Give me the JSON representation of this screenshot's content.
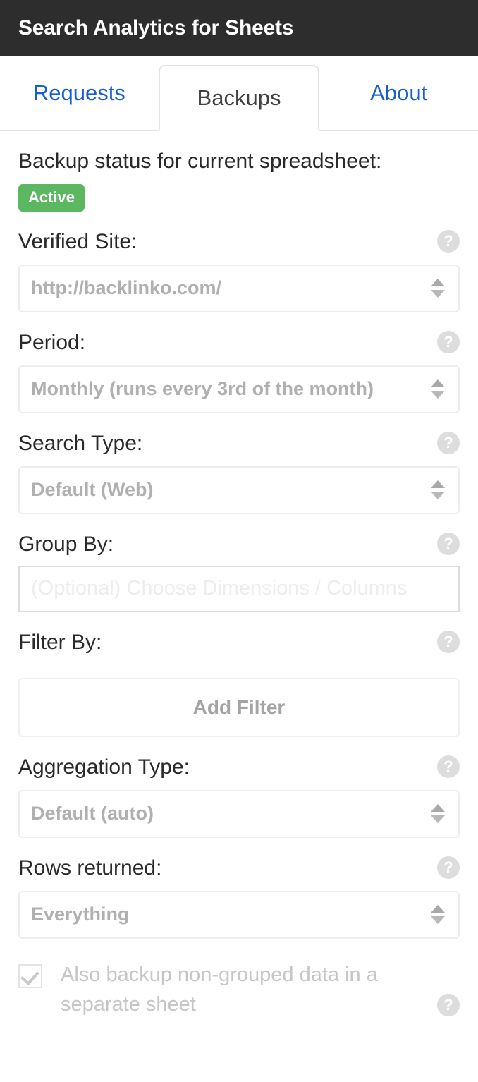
{
  "header": {
    "title": "Search Analytics for Sheets",
    "background_color": "#2d2d2d",
    "title_color": "#ffffff"
  },
  "tabs": [
    {
      "label": "Requests",
      "active": false
    },
    {
      "label": "Backups",
      "active": true
    },
    {
      "label": "About",
      "active": false
    }
  ],
  "tab_colors": {
    "inactive_text": "#1a5fd0",
    "active_text": "#3f3f3f",
    "border": "#e3e3e3"
  },
  "status": {
    "label": "Backup status for current spreadsheet:",
    "badge_text": "Active",
    "badge_color": "#5cb860"
  },
  "help_icon": {
    "glyph": "?",
    "name": "help-icon",
    "color": "#dddddd"
  },
  "fields": {
    "verified_site": {
      "label": "Verified Site:",
      "value": "http://backlinko.com/"
    },
    "period": {
      "label": "Period:",
      "value": "Monthly (runs every 3rd of the month)"
    },
    "search_type": {
      "label": "Search Type:",
      "value": "Default (Web)"
    },
    "group_by": {
      "label": "Group By:",
      "placeholder": "(Optional) Choose Dimensions / Columns",
      "value": ""
    },
    "filter_by": {
      "label": "Filter By:",
      "add_filter_label": "Add Filter"
    },
    "aggregation_type": {
      "label": "Aggregation Type:",
      "value": "Default (auto)"
    },
    "rows_returned": {
      "label": "Rows returned:",
      "value": "Everything"
    },
    "non_grouped_backup": {
      "label": "Also backup non-grouped data in a separate sheet",
      "checked": true
    }
  }
}
